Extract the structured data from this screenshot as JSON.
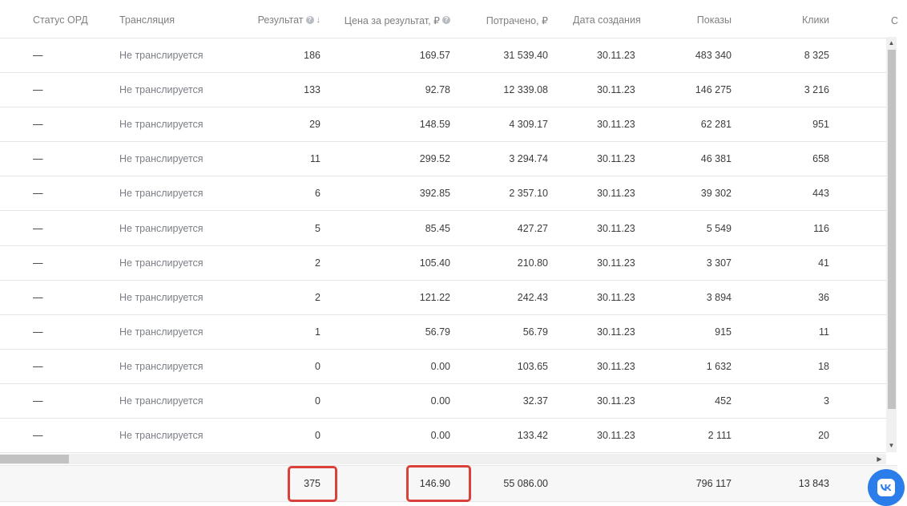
{
  "table": {
    "columns": {
      "ord_status": "Статус ОРД",
      "broadcast": "Трансляция",
      "result": "Результат",
      "price_per_result": "Цена за результат, ₽",
      "spent": "Потрачено, ₽",
      "created": "Дата создания",
      "impressions": "Показы",
      "clicks": "Клики",
      "next_partial": "С"
    },
    "help_glyph": "?",
    "sort_glyph": "↓",
    "rows": [
      {
        "ord_status": "—",
        "broadcast": "Не транслируется",
        "result": "186",
        "price": "169.57",
        "spent": "31 539.40",
        "created": "30.11.23",
        "impressions": "483 340",
        "clicks": "8 325"
      },
      {
        "ord_status": "—",
        "broadcast": "Не транслируется",
        "result": "133",
        "price": "92.78",
        "spent": "12 339.08",
        "created": "30.11.23",
        "impressions": "146 275",
        "clicks": "3 216"
      },
      {
        "ord_status": "—",
        "broadcast": "Не транслируется",
        "result": "29",
        "price": "148.59",
        "spent": "4 309.17",
        "created": "30.11.23",
        "impressions": "62 281",
        "clicks": "951"
      },
      {
        "ord_status": "—",
        "broadcast": "Не транслируется",
        "result": "11",
        "price": "299.52",
        "spent": "3 294.74",
        "created": "30.11.23",
        "impressions": "46 381",
        "clicks": "658"
      },
      {
        "ord_status": "—",
        "broadcast": "Не транслируется",
        "result": "6",
        "price": "392.85",
        "spent": "2 357.10",
        "created": "30.11.23",
        "impressions": "39 302",
        "clicks": "443"
      },
      {
        "ord_status": "—",
        "broadcast": "Не транслируется",
        "result": "5",
        "price": "85.45",
        "spent": "427.27",
        "created": "30.11.23",
        "impressions": "5 549",
        "clicks": "116"
      },
      {
        "ord_status": "—",
        "broadcast": "Не транслируется",
        "result": "2",
        "price": "105.40",
        "spent": "210.80",
        "created": "30.11.23",
        "impressions": "3 307",
        "clicks": "41"
      },
      {
        "ord_status": "—",
        "broadcast": "Не транслируется",
        "result": "2",
        "price": "121.22",
        "spent": "242.43",
        "created": "30.11.23",
        "impressions": "3 894",
        "clicks": "36"
      },
      {
        "ord_status": "—",
        "broadcast": "Не транслируется",
        "result": "1",
        "price": "56.79",
        "spent": "56.79",
        "created": "30.11.23",
        "impressions": "915",
        "clicks": "11"
      },
      {
        "ord_status": "—",
        "broadcast": "Не транслируется",
        "result": "0",
        "price": "0.00",
        "spent": "103.65",
        "created": "30.11.23",
        "impressions": "1 632",
        "clicks": "18"
      },
      {
        "ord_status": "—",
        "broadcast": "Не транслируется",
        "result": "0",
        "price": "0.00",
        "spent": "32.37",
        "created": "30.11.23",
        "impressions": "452",
        "clicks": "3"
      },
      {
        "ord_status": "—",
        "broadcast": "Не транслируется",
        "result": "0",
        "price": "0.00",
        "spent": "133.42",
        "created": "30.11.23",
        "impressions": "2 111",
        "clicks": "20"
      }
    ],
    "totals": {
      "result": "375",
      "price": "146.90",
      "spent": "55 086.00",
      "impressions": "796 117",
      "clicks": "13 843"
    }
  },
  "scrollbars": {
    "up_arrow": "▲",
    "down_arrow": "▼",
    "right_arrow": "▶"
  },
  "colors": {
    "highlight": "#d9413a",
    "vk_button": "#2b7de9"
  },
  "icons": {
    "vk_button": "vk-logo-icon"
  }
}
